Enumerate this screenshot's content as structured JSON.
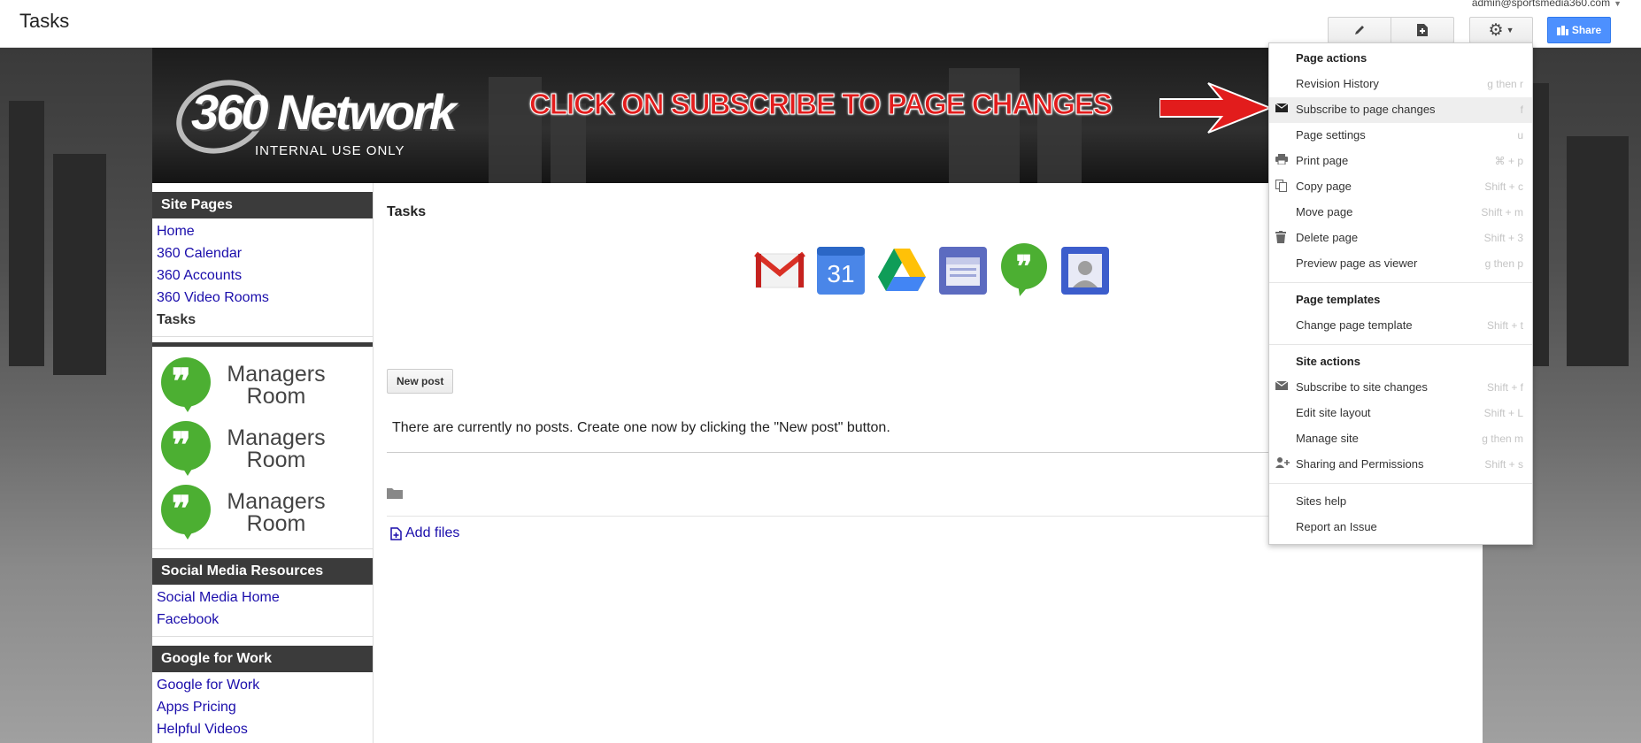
{
  "top": {
    "title": "Tasks",
    "account": "admin@sportsmedia360.com",
    "share": "Share"
  },
  "banner": {
    "logo_main": "360 Network",
    "logo_sub": "INTERNAL USE ONLY",
    "callout": "CLICK ON SUBSCRIBE TO PAGE CHANGES"
  },
  "sidebar": {
    "site_pages": {
      "heading": "Site Pages",
      "items": [
        "Home",
        "360 Calendar",
        "360 Accounts",
        "360 Video Rooms",
        "Tasks"
      ]
    },
    "hangouts": [
      "Managers Room",
      "Managers Room",
      "Managers Room"
    ],
    "social": {
      "heading": "Social Media Resources",
      "items": [
        "Social Media Home",
        "Facebook"
      ]
    },
    "google": {
      "heading": "Google for Work",
      "items": [
        "Google for Work",
        "Apps Pricing",
        "Helpful Videos"
      ]
    }
  },
  "main": {
    "title": "Tasks",
    "apps": [
      "gmail",
      "calendar",
      "drive",
      "sites",
      "hangouts",
      "contacts"
    ],
    "calendar_number": "31",
    "new_post": "New post",
    "empty_message": "There are currently no posts. Create one now by clicking the \"New post\" button.",
    "add_files": "Add files"
  },
  "menu": {
    "page_actions": "Page actions",
    "items": [
      {
        "label": "Revision History",
        "shortcut": "g then r"
      },
      {
        "label": "Subscribe to page changes",
        "shortcut": "f"
      },
      {
        "label": "Page settings",
        "shortcut": "u"
      },
      {
        "label": "Print page",
        "shortcut": "⌘ + p"
      },
      {
        "label": "Copy page",
        "shortcut": "Shift + c"
      },
      {
        "label": "Move page",
        "shortcut": "Shift + m"
      },
      {
        "label": "Delete page",
        "shortcut": "Shift + 3"
      },
      {
        "label": "Preview page as viewer",
        "shortcut": "g then p"
      }
    ],
    "page_templates": "Page templates",
    "template_items": [
      {
        "label": "Change page template",
        "shortcut": "Shift + t"
      }
    ],
    "site_actions": "Site actions",
    "site_items": [
      {
        "label": "Subscribe to site changes",
        "shortcut": "Shift + f"
      },
      {
        "label": "Edit site layout",
        "shortcut": "Shift + L"
      },
      {
        "label": "Manage site",
        "shortcut": "g then m"
      },
      {
        "label": "Sharing and Permissions",
        "shortcut": "Shift + s"
      }
    ],
    "help_items": [
      "Sites help",
      "Report an Issue"
    ]
  },
  "colors": {
    "accent_blue": "#4d90fe",
    "link": "#1a0dab",
    "callout_red": "#e21c1c",
    "hangouts_green": "#4caf32"
  }
}
